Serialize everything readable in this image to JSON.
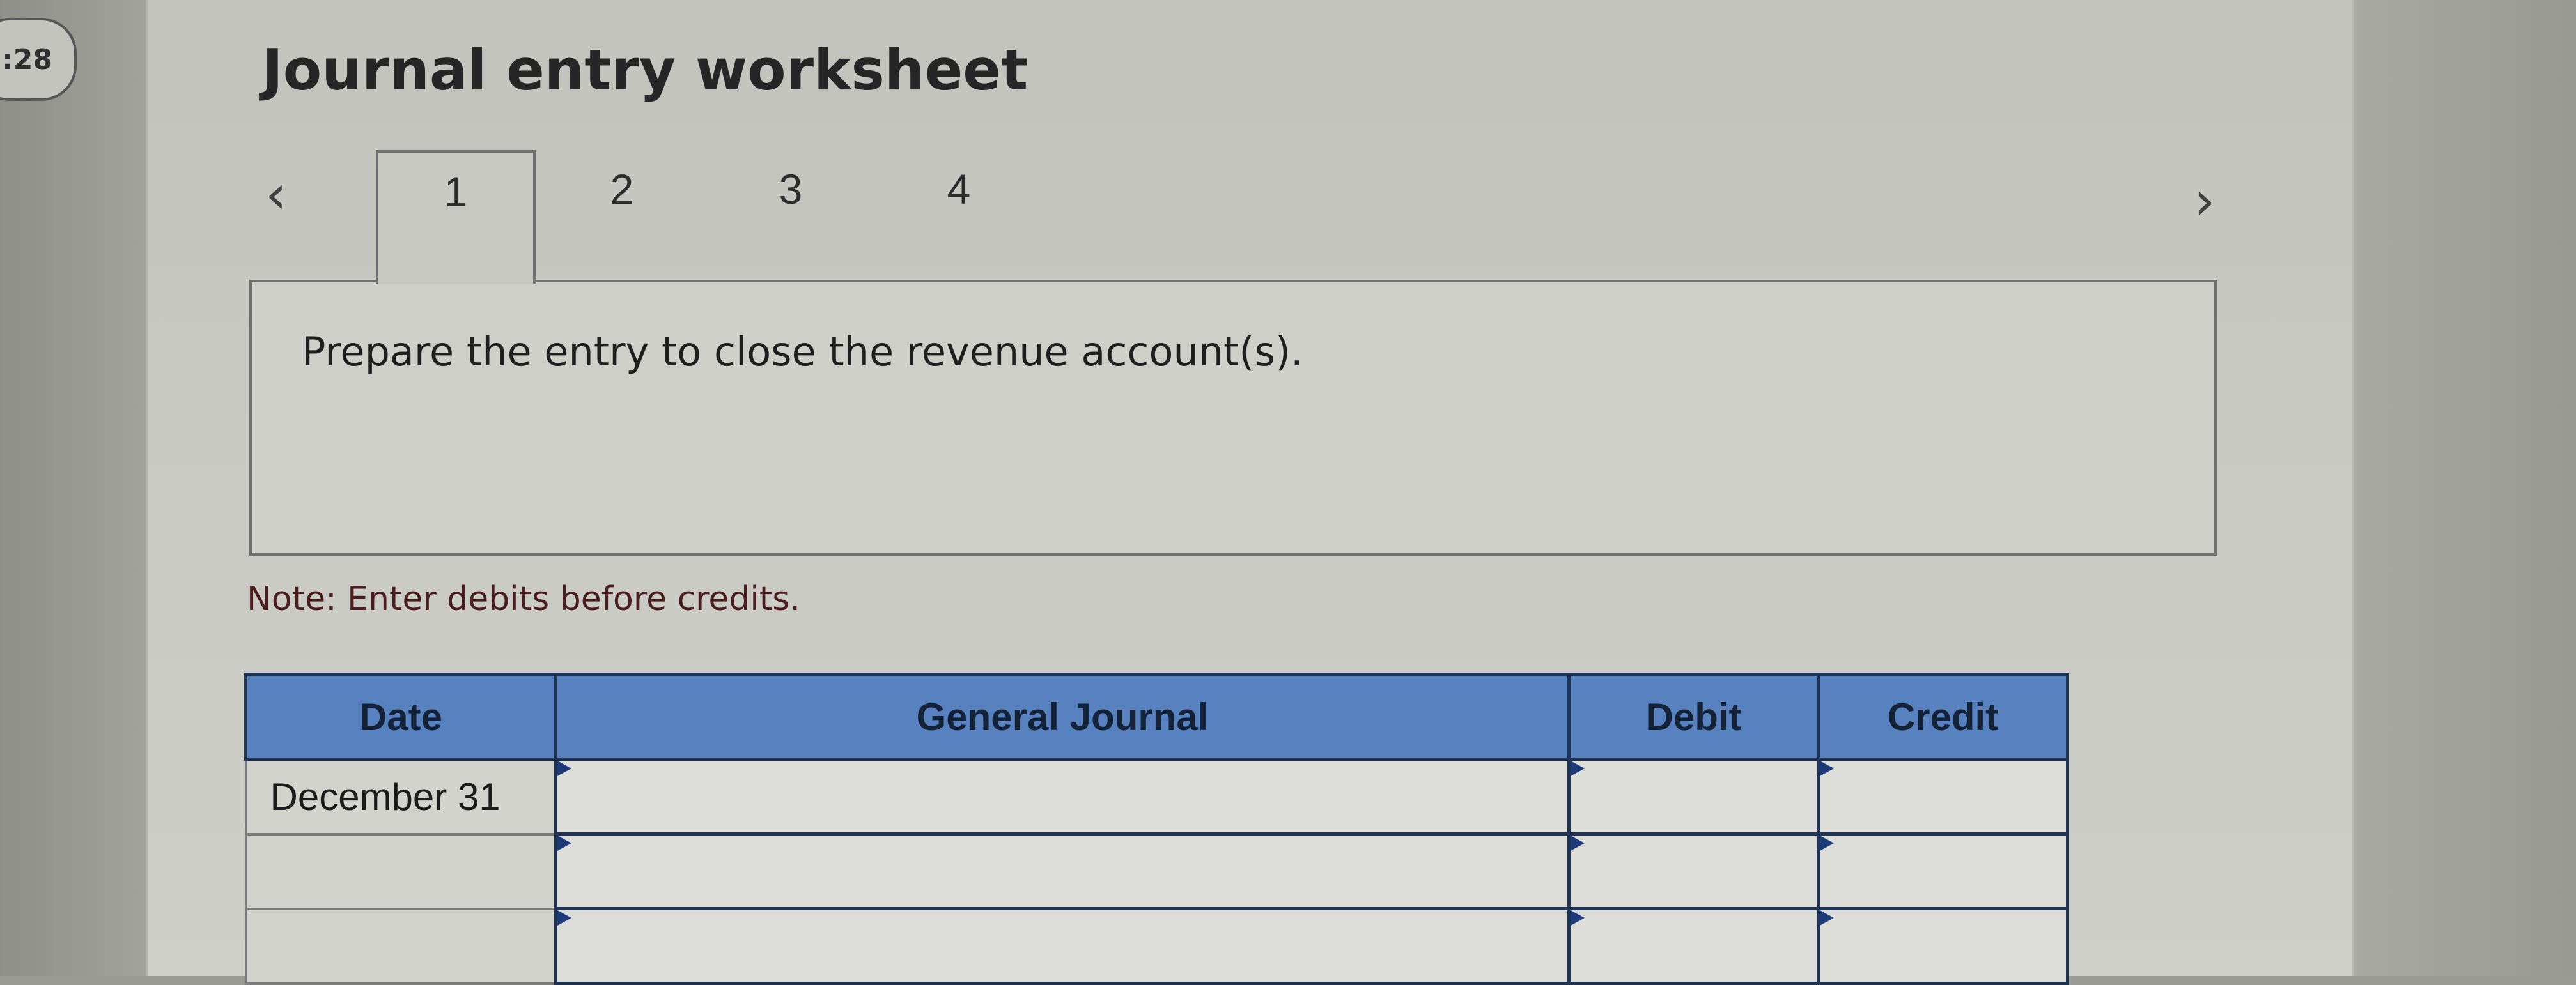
{
  "timer": {
    "label": ":28"
  },
  "worksheet": {
    "title": "Journal entry worksheet",
    "nav": {
      "prev_icon": "chevron-left-icon",
      "next_icon": "chevron-right-icon"
    },
    "tabs": [
      {
        "label": "1",
        "active": true
      },
      {
        "label": "2",
        "active": false
      },
      {
        "label": "3",
        "active": false
      },
      {
        "label": "4",
        "active": false
      }
    ],
    "instruction": "Prepare the entry to close the revenue account(s).",
    "note": "Note: Enter debits before credits."
  },
  "journal_table": {
    "headers": {
      "date": "Date",
      "general_journal": "General Journal",
      "debit": "Debit",
      "credit": "Credit"
    },
    "rows": [
      {
        "date": "December 31",
        "account": "",
        "debit": "",
        "credit": ""
      },
      {
        "date": "",
        "account": "",
        "debit": "",
        "credit": ""
      },
      {
        "date": "",
        "account": "",
        "debit": "",
        "credit": ""
      }
    ]
  },
  "colors": {
    "header_bg": "#5781bf",
    "grid_border": "#1f3354",
    "note_text": "#4a1e1e"
  }
}
